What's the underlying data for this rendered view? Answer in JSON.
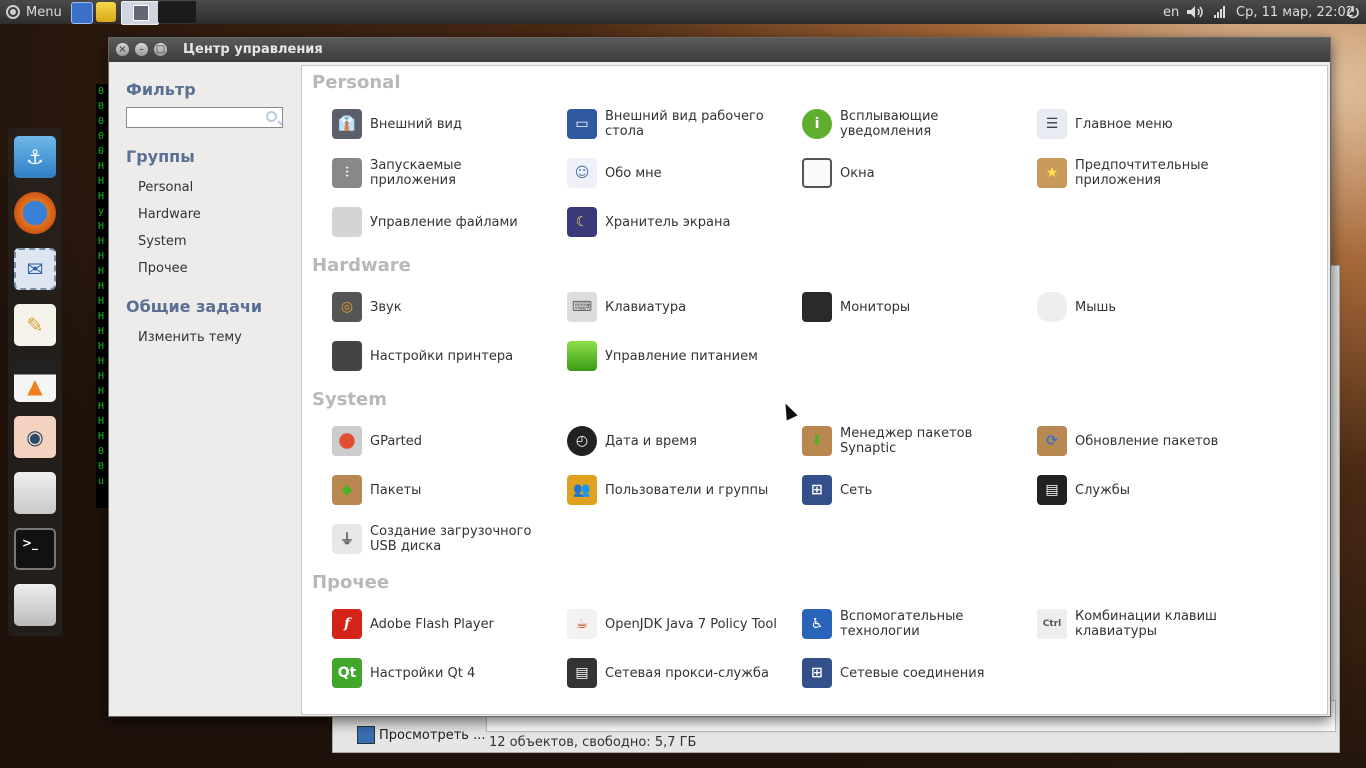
{
  "top_panel": {
    "menu_label": "Menu",
    "keyboard_layout": "en",
    "datetime": "Ср, 11 мар, 22:02"
  },
  "terminal_bg_chars": [
    "0",
    "0",
    "0",
    "0",
    "0",
    "H",
    "H",
    "H",
    "y",
    "H",
    "H",
    "H",
    "H",
    "H",
    "H",
    "H",
    "H",
    "H",
    "H",
    "H",
    "H",
    "H",
    "H",
    "H",
    "0",
    "0",
    "u"
  ],
  "window": {
    "title": "Центр управления"
  },
  "sidebar": {
    "filter_heading": "Фильтр",
    "search_value": "",
    "groups_heading": "Группы",
    "groups": [
      "Personal",
      "Hardware",
      "System",
      "Прочее"
    ],
    "tasks_heading": "Общие задачи",
    "tasks": [
      "Изменить тему"
    ]
  },
  "sections": {
    "personal": {
      "title": "Personal",
      "items": [
        "Внешний вид",
        "Внешний вид рабочего стола",
        "Всплывающие уведомления",
        "Главное меню",
        "Запускаемые приложения",
        "Обо мне",
        "Окна",
        "Предпочтительные приложения",
        "Управление файлами",
        "Хранитель экрана"
      ]
    },
    "hardware": {
      "title": "Hardware",
      "items": [
        "Звук",
        "Клавиатура",
        "Мониторы",
        "Мышь",
        "Настройки принтера",
        "Управление питанием"
      ]
    },
    "system": {
      "title": "System",
      "items": [
        "GParted",
        "Дата и время",
        "Менеджер пакетов Synaptic",
        "Обновление пакетов",
        "Пакеты",
        "Пользователи и группы",
        "Сеть",
        "Службы",
        "Создание загрузочного USB диска"
      ]
    },
    "other": {
      "title": "Прочее",
      "items": [
        "Adobe Flash Player",
        "OpenJDK Java 7 Policy Tool",
        "Вспомогательные технологии",
        "Комбинации клавиш клавиатуры",
        "Настройки Qt 4",
        "Сетевая прокси-служба",
        "Сетевые соединения"
      ]
    }
  },
  "file_manager_back": {
    "view_button": "Просмотреть ...",
    "status": "12 объектов, свободно: 5,7 ГБ"
  },
  "colors": {
    "section_title": "#b8b8b8",
    "sidebar_heading": "#5a6f94"
  }
}
